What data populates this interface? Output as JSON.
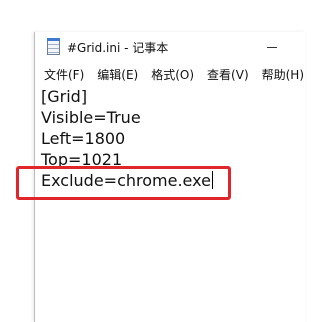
{
  "window": {
    "title": "#Grid.ini - 记事本"
  },
  "menubar": {
    "items": [
      {
        "label": "文件(F)"
      },
      {
        "label": "编辑(E)"
      },
      {
        "label": "格式(O)"
      },
      {
        "label": "查看(V)"
      },
      {
        "label": "帮助(H)"
      }
    ]
  },
  "editor": {
    "lines": [
      "[Grid]",
      "Visible=True",
      "Left=1800",
      "Top=1021",
      "Exclude=chrome.exe"
    ]
  },
  "colors": {
    "highlight": "#e0262a"
  }
}
